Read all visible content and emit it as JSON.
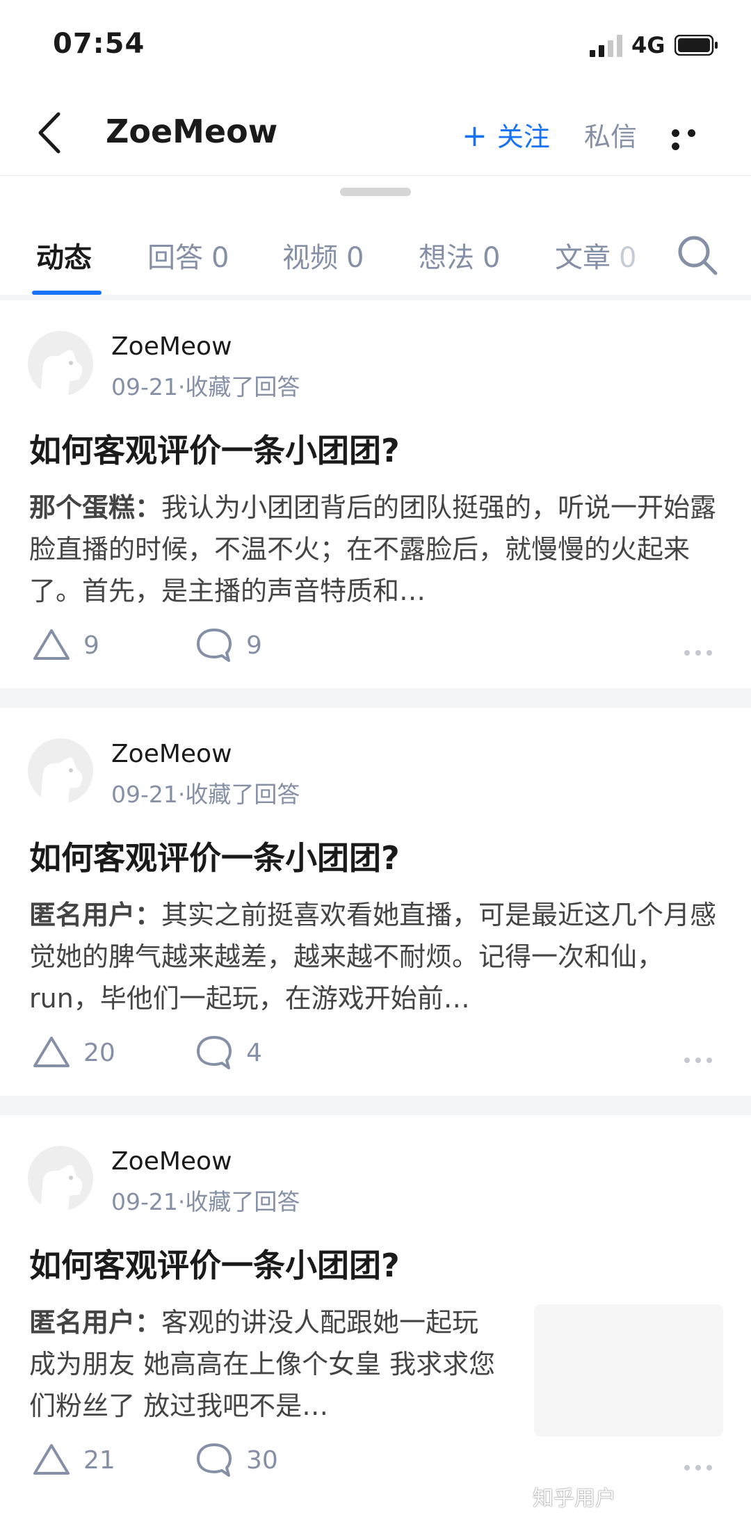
{
  "status_bar": {
    "time": "07:54",
    "network": "4G"
  },
  "header": {
    "title": "ZoeMeow",
    "follow_label": "关注",
    "message_label": "私信"
  },
  "tabs": [
    {
      "label": "动态",
      "count": ""
    },
    {
      "label": "回答",
      "count": "0"
    },
    {
      "label": "视频",
      "count": "0"
    },
    {
      "label": "想法",
      "count": "0"
    },
    {
      "label": "文章",
      "count": "0"
    }
  ],
  "feed": [
    {
      "author": "ZoeMeow",
      "meta": "09-21·收藏了回答",
      "question": "如何客观评价一条小团团?",
      "answerer": "那个蛋糕：",
      "excerpt": "我认为小团团背后的团队挺强的，听说一开始露脸直播的时候，不温不火；在不露脸后，就慢慢的火起来了。首先，是主播的声音特质和…",
      "likes": "9",
      "comments": "9"
    },
    {
      "author": "ZoeMeow",
      "meta": "09-21·收藏了回答",
      "question": "如何客观评价一条小团团?",
      "answerer": "匿名用户：",
      "excerpt": "其实之前挺喜欢看她直播，可是最近这几个月感觉她的脾气越来越差，越来越不耐烦。记得一次和仙，run，毕他们一起玩，在游戏开始前…",
      "likes": "20",
      "comments": "4"
    },
    {
      "author": "ZoeMeow",
      "meta": "09-21·收藏了回答",
      "question": "如何客观评价一条小团团?",
      "answerer": "匿名用户：",
      "excerpt": "客观的讲没人配跟她一起玩成为朋友 她高高在上像个女皇 我求求您们粉丝了 放过我吧不是…",
      "likes": "21",
      "comments": "30"
    }
  ],
  "watermark": "知乎用户",
  "colors": {
    "accent": "#1772f6",
    "secondary_text": "#8590a6",
    "separator": "#f4f5f7"
  }
}
